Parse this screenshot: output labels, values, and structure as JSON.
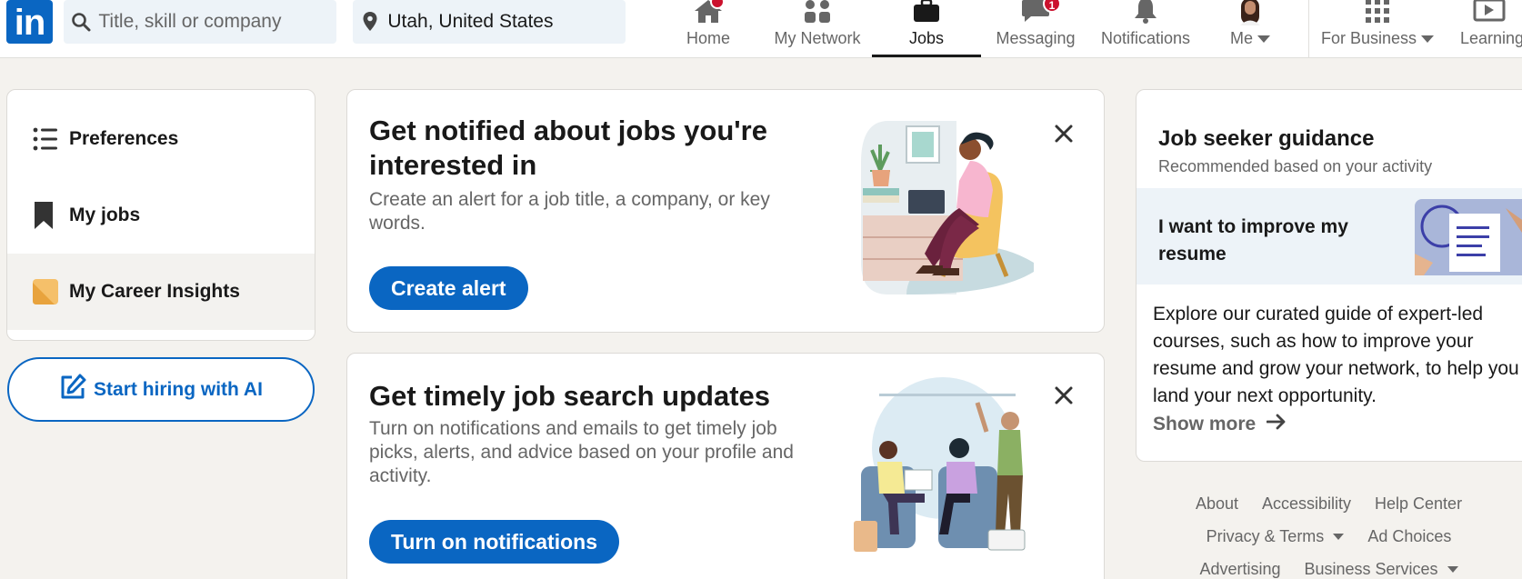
{
  "header": {
    "logo_text": "in",
    "search_placeholder": "Title, skill or company",
    "location_value": "Utah, United States",
    "nav": [
      {
        "label": "Home",
        "icon": "home-icon",
        "badge": ""
      },
      {
        "label": "My Network",
        "icon": "people-icon",
        "badge": ""
      },
      {
        "label": "Jobs",
        "icon": "briefcase-icon",
        "badge": ""
      },
      {
        "label": "Messaging",
        "icon": "messaging-icon",
        "badge": "1"
      },
      {
        "label": "Notifications",
        "icon": "bell-icon",
        "badge": ""
      },
      {
        "label": "Me",
        "icon": "avatar",
        "badge": ""
      },
      {
        "label": "For Business",
        "icon": "grid-icon",
        "badge": ""
      },
      {
        "label": "Learning",
        "icon": "learning-icon",
        "badge": ""
      }
    ]
  },
  "sidebar": {
    "items": [
      {
        "label": "Preferences",
        "icon": "list-icon"
      },
      {
        "label": "My jobs",
        "icon": "bookmark-icon"
      },
      {
        "label": "My Career Insights",
        "icon": "insights-icon"
      }
    ],
    "hire_button": "Start hiring with AI"
  },
  "promos": [
    {
      "title": "Get notified about jobs you're interested in",
      "description": "Create an alert for a job title, a company, or key words.",
      "button": "Create alert"
    },
    {
      "title": "Get timely job search updates",
      "description": "Turn on notifications and emails to get timely job picks, alerts, and advice based on your profile and activity.",
      "button": "Turn on notifications"
    }
  ],
  "guidance": {
    "title": "Job seeker guidance",
    "subtitle": "Recommended based on your activity",
    "topic": "I want to improve my resume",
    "body": "Explore our curated guide of expert-led courses, such as how to improve your resume and grow your network, to help you land your next opportunity.",
    "show_more": "Show more"
  },
  "footer": {
    "row1": [
      "About",
      "Accessibility",
      "Help Center"
    ],
    "row2": [
      "Privacy & Terms",
      "Ad Choices"
    ],
    "row3": [
      "Advertising",
      "Business Services"
    ]
  },
  "colors": {
    "brand": "#0a66c2",
    "badge": "#cb112d",
    "background": "#f4f2ee"
  }
}
